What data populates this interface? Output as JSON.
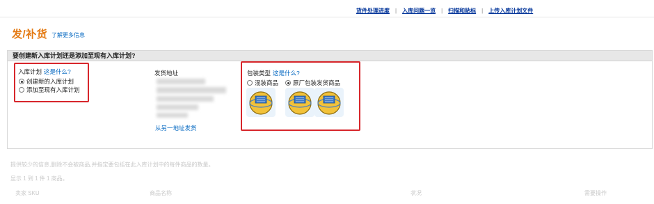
{
  "nav": {
    "links": [
      "货件处理进度",
      "入库问题一览",
      "扫描和贴标",
      "上传入库计划文件"
    ],
    "separator": "|"
  },
  "page": {
    "title": "发/补货",
    "learn_more": "了解更多信息"
  },
  "panel": {
    "heading": "要创建新入库计划还是添加至现有入库计划?",
    "plan": {
      "label": "入库计划",
      "help": "这是什么?",
      "options": [
        {
          "label": "创建新的入库计划",
          "selected": true
        },
        {
          "label": "添加至现有入库计划",
          "selected": false
        }
      ]
    },
    "ship_from": {
      "label": "发货地址",
      "alt_link": "从另一地址发货"
    },
    "packing": {
      "label": "包装类型",
      "help": "这是什么?",
      "options": [
        {
          "label": "混装商品",
          "selected": false
        },
        {
          "label": "原厂包装发货商品",
          "selected": true
        }
      ],
      "icon": "box-globe-icon"
    }
  },
  "below": {
    "note": "提供较少的信息,删除不会被商品,并指定要包括在此入库计划中的每件商品的数量。",
    "count": "显示 1 到 1 件 1 商品。",
    "columns": [
      "卖家 SKU",
      "商品名称",
      "状况",
      "需要操作"
    ]
  },
  "colors": {
    "accent_orange": "#e47911",
    "link_blue": "#0066c0",
    "highlight_red": "#d7262b"
  }
}
